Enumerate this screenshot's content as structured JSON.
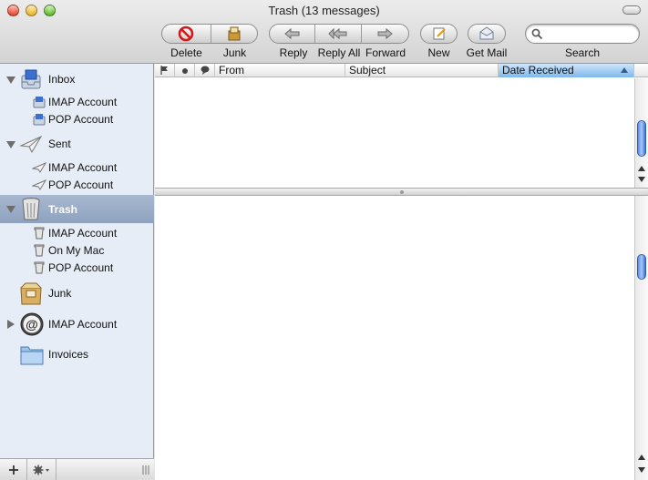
{
  "window": {
    "title": "Trash (13 messages)"
  },
  "toolbar": {
    "delete_label": "Delete",
    "junk_label": "Junk",
    "reply_label": "Reply",
    "reply_all_label": "Reply All",
    "forward_label": "Forward",
    "new_label": "New",
    "get_mail_label": "Get Mail",
    "search_label": "Search",
    "search_placeholder": ""
  },
  "sidebar": {
    "mailboxes": [
      {
        "label": "Inbox",
        "icon": "inbox-icon",
        "expanded": true,
        "children": [
          {
            "label": "IMAP Account"
          },
          {
            "label": "POP Account"
          }
        ]
      },
      {
        "label": "Sent",
        "icon": "sent-icon",
        "expanded": true,
        "children": [
          {
            "label": "IMAP Account"
          },
          {
            "label": "POP Account"
          }
        ]
      },
      {
        "label": "Trash",
        "icon": "trash-icon",
        "expanded": true,
        "selected": true,
        "children": [
          {
            "label": "IMAP Account"
          },
          {
            "label": "On My Mac"
          },
          {
            "label": "POP Account"
          }
        ]
      },
      {
        "label": "Junk",
        "icon": "junk-icon"
      },
      {
        "label": "IMAP Account",
        "icon": "at-sign-icon",
        "expanded": false
      },
      {
        "label": "Invoices",
        "icon": "folder-icon"
      }
    ]
  },
  "message_list": {
    "columns": [
      {
        "label": ""
      },
      {
        "label": ""
      },
      {
        "label": ""
      },
      {
        "label": "From"
      },
      {
        "label": "Subject"
      },
      {
        "label": "Date Received",
        "sorted": "ascending"
      }
    ]
  },
  "colors": {
    "sidebar_bg": "#e7edf6",
    "selection": "#8ea2bf",
    "column_active": "#7fb8ec",
    "scroll_thumb": "#5b8ee6"
  }
}
